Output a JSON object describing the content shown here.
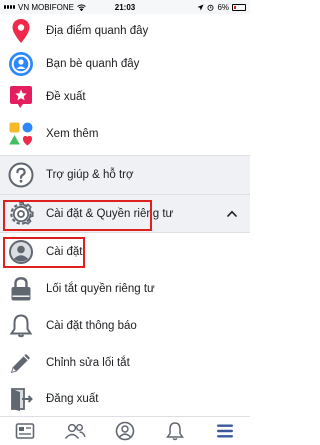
{
  "status_bar": {
    "carrier": "VN MOBIFONE",
    "time": "21:03",
    "battery": "6%"
  },
  "menu": {
    "items": [
      {
        "label": "Địa điểm quanh đây",
        "icon": "location-pin-icon"
      },
      {
        "label": "Bạn bè quanh đây",
        "icon": "friends-nearby-icon"
      },
      {
        "label": "Đề xuất",
        "icon": "recommendations-icon"
      },
      {
        "label": "Xem thêm",
        "icon": "see-more-icon"
      },
      {
        "label": "Trợ giúp & hỗ trợ",
        "icon": "help-icon"
      },
      {
        "label": "Cài đặt & Quyền riêng tư",
        "icon": "gear-icon"
      },
      {
        "label": "Cài đặt",
        "icon": "profile-settings-icon"
      },
      {
        "label": "Lối tắt quyền riêng tư",
        "icon": "lock-icon"
      },
      {
        "label": "Cài đặt thông báo",
        "icon": "bell-icon"
      },
      {
        "label": "Chỉnh sửa lối tắt",
        "icon": "edit-icon"
      },
      {
        "label": "Đăng xuất",
        "icon": "logout-icon"
      }
    ]
  },
  "tabbar": {
    "tabs": [
      "news-feed-icon",
      "friends-icon",
      "profile-icon",
      "notifications-icon",
      "menu-icon"
    ],
    "active": "menu-icon"
  },
  "colors": {
    "accent": "#3b5998",
    "highlight": "#e0201f",
    "section_bg": "#f0f1f4"
  }
}
